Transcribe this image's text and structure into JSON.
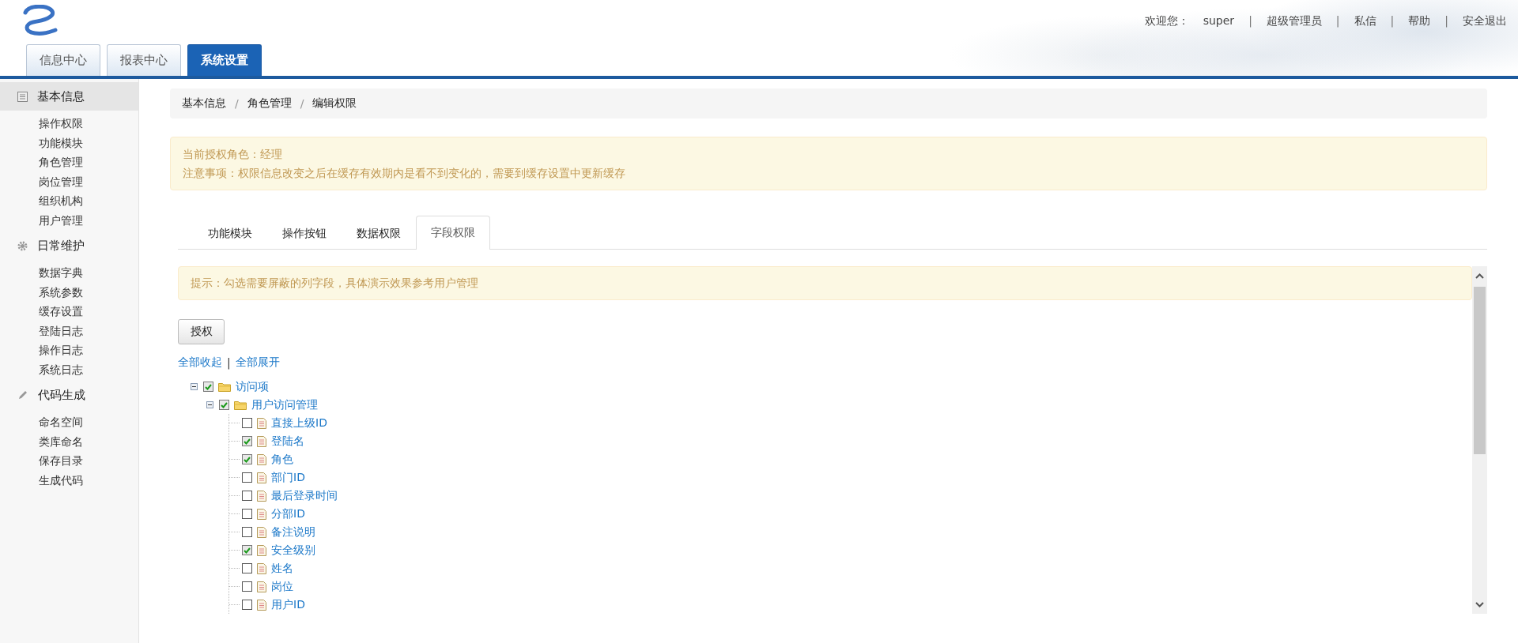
{
  "header": {
    "welcome": "欢迎您：",
    "user": "super",
    "separator": "|",
    "links": [
      "超级管理员",
      "私信",
      "帮助",
      "安全退出"
    ]
  },
  "top_tabs": [
    {
      "label": "信息中心",
      "selected": false
    },
    {
      "label": "报表中心",
      "selected": false
    },
    {
      "label": "系统设置",
      "selected": true
    }
  ],
  "sidebar": {
    "groups": [
      {
        "title": "基本信息",
        "kind": "list",
        "selected": true,
        "items": [
          "操作权限",
          "功能模块",
          "角色管理",
          "岗位管理",
          "组织机构",
          "用户管理"
        ]
      },
      {
        "title": "日常维护",
        "kind": "gear",
        "selected": false,
        "items": [
          "数据字典",
          "系统参数",
          "缓存设置",
          "登陆日志",
          "操作日志",
          "系统日志"
        ]
      },
      {
        "title": "代码生成",
        "kind": "pencil",
        "selected": false,
        "items": [
          "命名空间",
          "类库命名",
          "保存目录",
          "生成代码"
        ]
      }
    ]
  },
  "breadcrumb": {
    "separator": "/",
    "items": [
      "基本信息",
      "角色管理",
      "编辑权限"
    ]
  },
  "notice": [
    "当前授权角色：经理",
    "注意事项：权限信息改变之后在缓存有效期内是看不到变化的，需要到缓存设置中更新缓存"
  ],
  "permission_tabs": [
    {
      "label": "功能模块",
      "selected": false
    },
    {
      "label": "操作按钮",
      "selected": false
    },
    {
      "label": "数据权限",
      "selected": false
    },
    {
      "label": "字段权限",
      "selected": true
    }
  ],
  "hint": "提示：勾选需要屏蔽的列字段，具体演示效果参考用户管理",
  "grant_button": "授权",
  "tree_actions": {
    "separator": "|",
    "links": [
      "全部收起",
      "全部展开"
    ]
  },
  "tree": [
    {
      "label": "访问项",
      "checked": true,
      "expanded": true,
      "children": [
        {
          "label": "用户访问管理",
          "checked": true,
          "expanded": true,
          "children": [
            {
              "label": "直接上级ID",
              "checked": false
            },
            {
              "label": "登陆名",
              "checked": true
            },
            {
              "label": "角色",
              "checked": true
            },
            {
              "label": "部门ID",
              "checked": false
            },
            {
              "label": "最后登录时间",
              "checked": false
            },
            {
              "label": "分部ID",
              "checked": false
            },
            {
              "label": "备注说明",
              "checked": false
            },
            {
              "label": "安全级别",
              "checked": true
            },
            {
              "label": "姓名",
              "checked": false
            },
            {
              "label": "岗位",
              "checked": false
            },
            {
              "label": "用户ID",
              "checked": false
            }
          ]
        }
      ]
    }
  ]
}
